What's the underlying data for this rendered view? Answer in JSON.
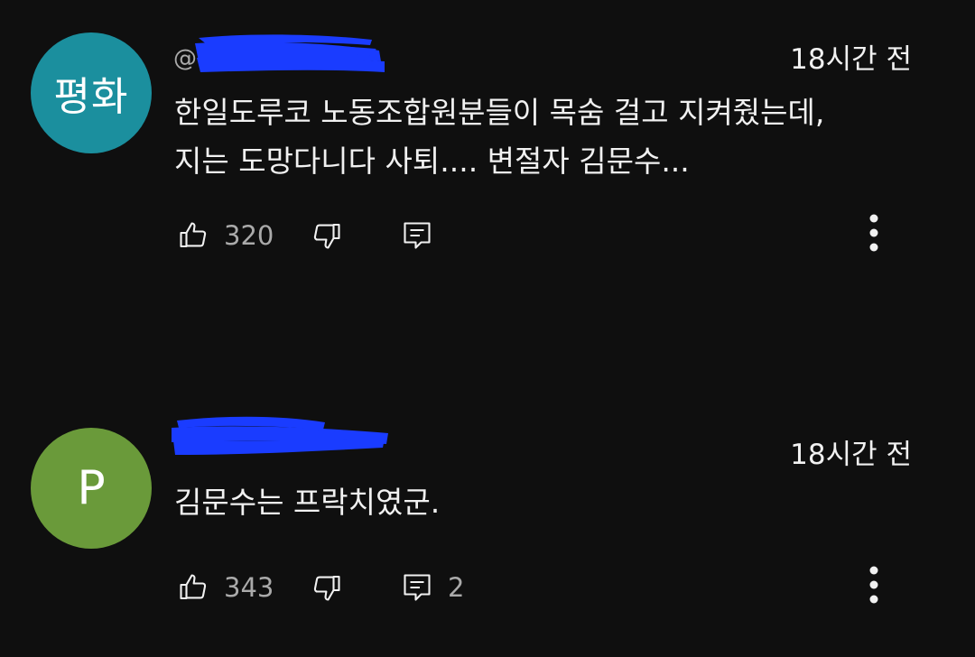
{
  "comments": [
    {
      "avatar_text": "평화",
      "avatar_color": "#1b8f9e",
      "handle_prefix": "@",
      "time": "18시간 전",
      "text": "한일도루코 노동조합원분들이 목숨 걸고 지켜줬는데,\n지는 도망다니다 사퇴.... 변절자 김문수...",
      "likes": "320",
      "replies": ""
    },
    {
      "avatar_text": "P",
      "avatar_color": "#6a9a3a",
      "handle_prefix": "",
      "time": "18시간 전",
      "text": "김문수는 프락치였군.",
      "likes": "343",
      "replies": "2"
    }
  ],
  "colors": {
    "background": "#0f0f0f",
    "text": "#f1f1f1",
    "secondary": "#aaaaaa",
    "redaction": "#1a3cff"
  },
  "icons": {
    "like": "thumbs-up-icon",
    "dislike": "thumbs-down-icon",
    "reply": "comment-icon",
    "more": "more-vertical-icon"
  }
}
